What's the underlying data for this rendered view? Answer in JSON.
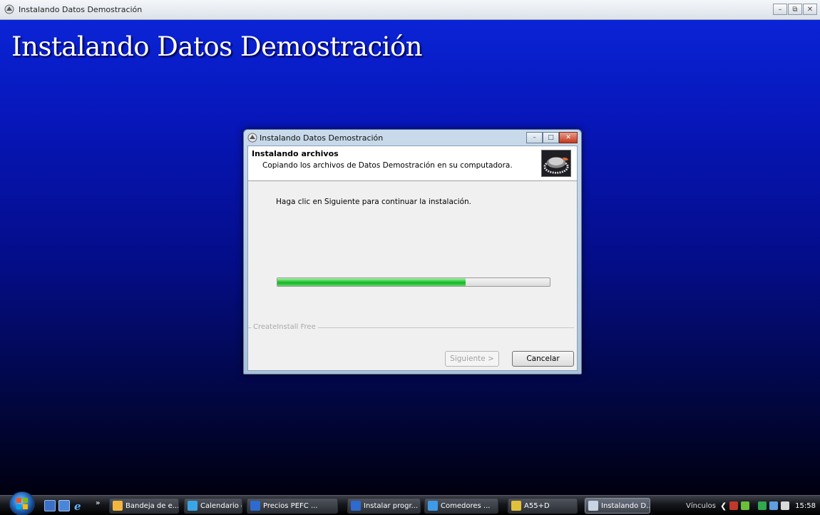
{
  "window": {
    "title": "Instalando Datos Demostración",
    "controls": [
      "minimize",
      "restore",
      "close"
    ]
  },
  "background": {
    "heading": "Instalando Datos Demostración"
  },
  "dialog": {
    "title": "Instalando Datos Demostración",
    "header_title": "Instalando archivos",
    "header_subtitle": "Copiando los archivos de Datos Demostración en su computadora.",
    "body_text": "Haga clic en Siguiente para continuar la instalación.",
    "progress": 0.69,
    "brand": "CreateInstall Free",
    "buttons": {
      "next": "Siguiente >",
      "cancel": "Cancelar"
    }
  },
  "taskbar": {
    "tasks": [
      {
        "label": "Bandeja de e...",
        "icon": "inbox-icon",
        "color": "#f2b640"
      },
      {
        "label": "Calendario d...",
        "icon": "calendar-icon",
        "color": "#3aa6e6"
      },
      {
        "label": "Precios PEFC ...",
        "icon": "word-icon",
        "color": "#2e6ad0"
      },
      {
        "label": "Instalar progr...",
        "icon": "word-icon",
        "color": "#2e6ad0"
      },
      {
        "label": "Comedores ...",
        "icon": "ie-icon",
        "color": "#3f9be8"
      },
      {
        "label": "A55+D",
        "icon": "app-icon",
        "color": "#e2c13a"
      },
      {
        "label": "Instalando D...",
        "icon": "installer-icon",
        "color": "#c8d4e4",
        "active": true
      }
    ],
    "tray_links": "Vínculos",
    "clock": "15:58"
  },
  "colors": {
    "desktop_top": "#0a24d6",
    "desktop_bottom": "#000010",
    "progress_green": "#16b224"
  }
}
